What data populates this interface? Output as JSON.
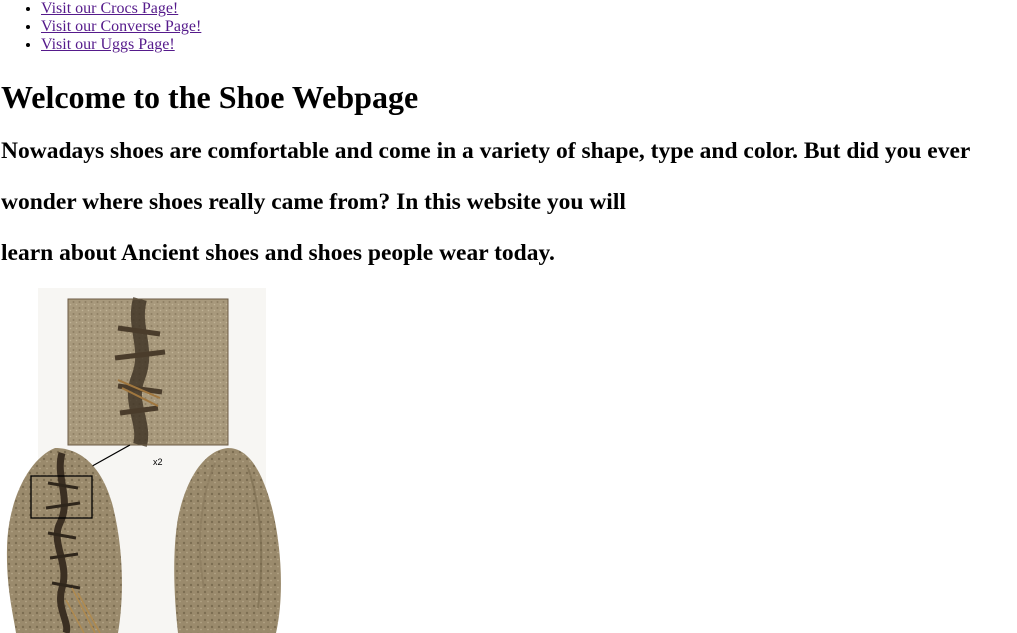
{
  "nav": {
    "links": [
      {
        "label": "Visit our Crocs Page!"
      },
      {
        "label": "Visit our Converse Page!"
      },
      {
        "label": "Visit our Uggs Page!"
      }
    ]
  },
  "heading": "Welcome to the Shoe Webpage",
  "intro": {
    "line1": "Nowadays shoes are comfortable and come in a variety of shape, type and color. But did you ever",
    "line2": "wonder where shoes really came from? In this website you will",
    "line3": "learn about Ancient shoes and shoes people wear today."
  },
  "image": {
    "zoom_label": "x2"
  },
  "colors": {
    "link": "#551a8b",
    "text": "#000000",
    "leather_light": "#b5a487",
    "leather_dark": "#6b5b44"
  }
}
